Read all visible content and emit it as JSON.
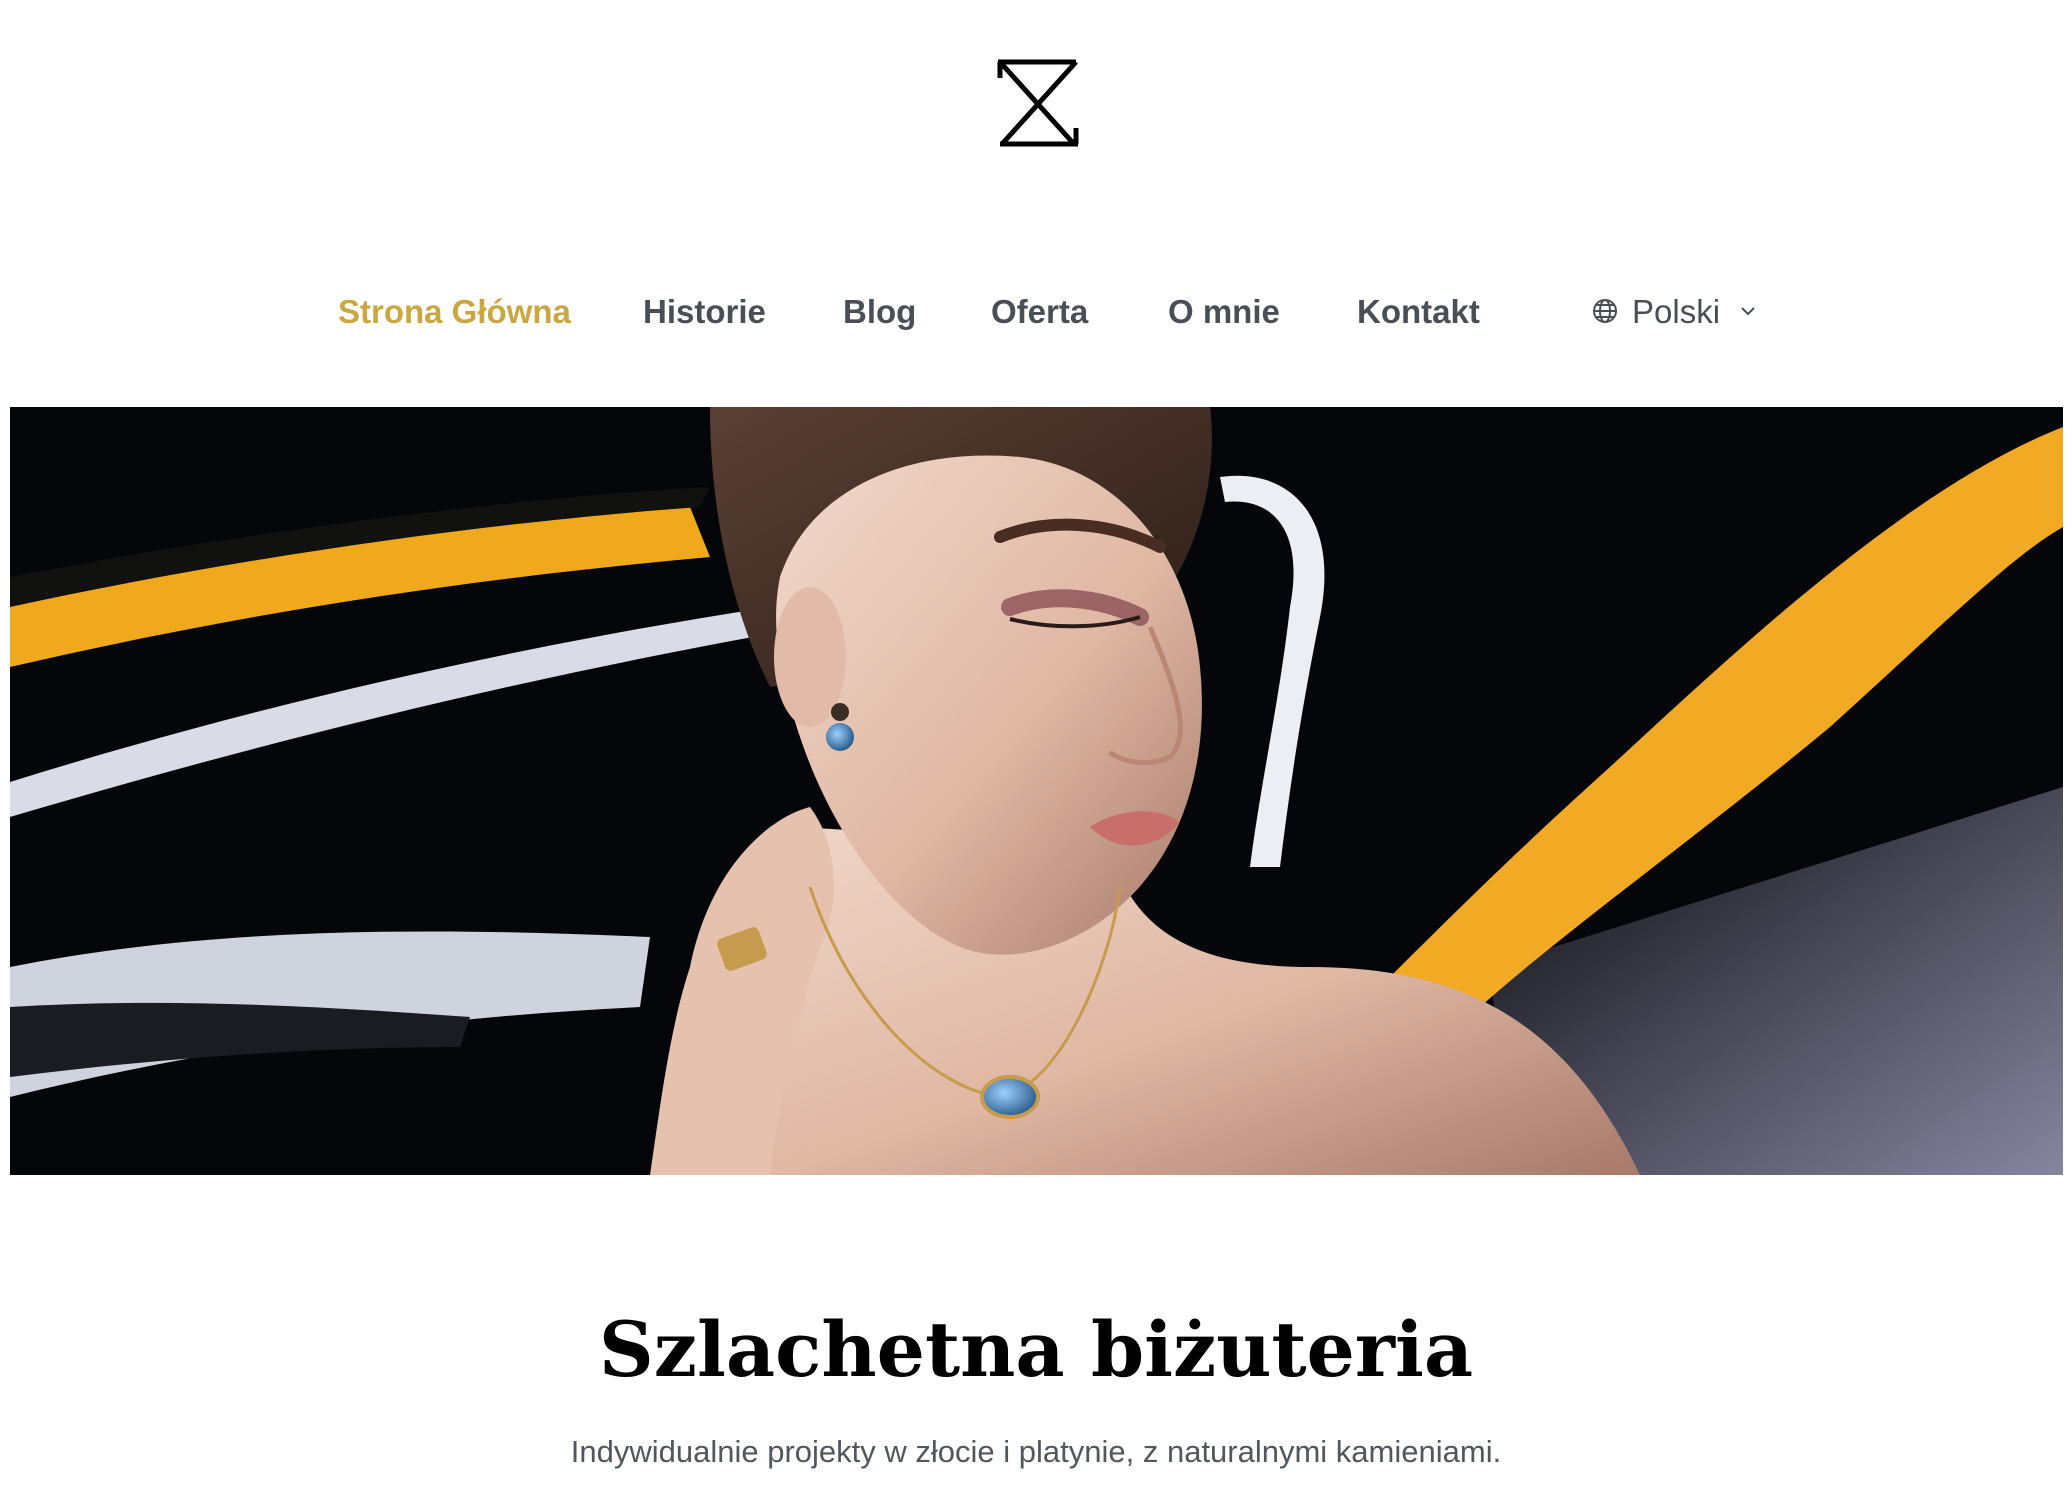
{
  "header": {
    "logo_icon": "hourglass-monogram-logo"
  },
  "nav": {
    "items": [
      {
        "label": "Strona Główna",
        "active": true
      },
      {
        "label": "Historie",
        "active": false
      },
      {
        "label": "Blog",
        "active": false
      },
      {
        "label": "Oferta",
        "active": false
      },
      {
        "label": "O mnie",
        "active": false
      },
      {
        "label": "Kontakt",
        "active": false
      }
    ],
    "language": {
      "icon": "globe-icon",
      "label": "Polski",
      "dropdown_icon": "chevron-down-icon"
    }
  },
  "hero": {
    "image": "model-wearing-jewelry-photo"
  },
  "main": {
    "title": "Szlachetna biżuteria",
    "subtitle": "Indywidualnie projekty w złocie i platynie, z naturalnymi kamieniami."
  },
  "colors": {
    "accent": "#c9a842",
    "nav_text": "#4a4f55",
    "title": "#000000",
    "subtitle": "#52575d"
  }
}
